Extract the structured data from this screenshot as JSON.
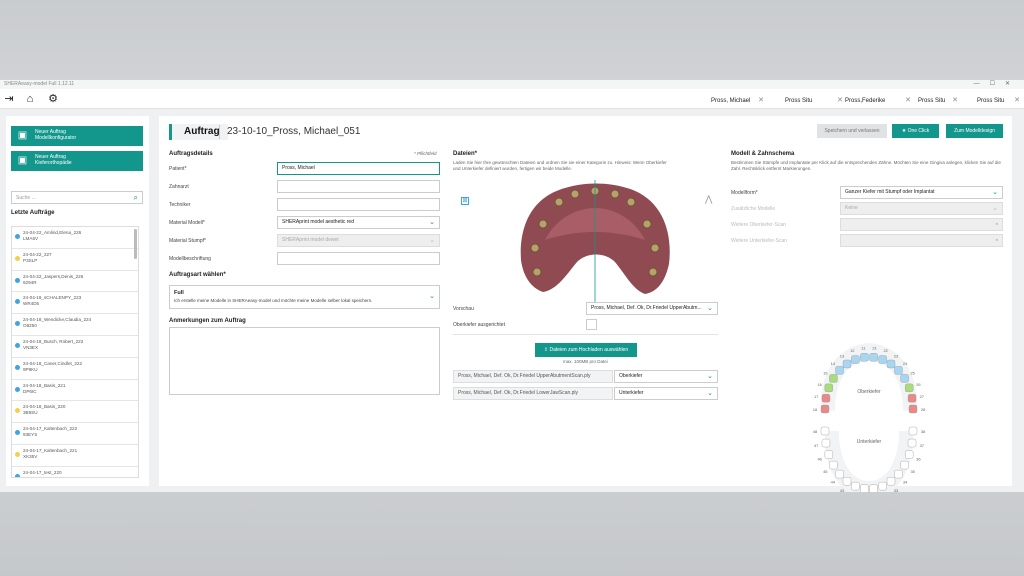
{
  "window": {
    "title": "SHERAeasy-model Full 1.12.11"
  },
  "tabs": [
    {
      "label": "Pross, Michael"
    },
    {
      "label": "Pross Situ"
    },
    {
      "label": "Pross,Federike"
    },
    {
      "label": "Pross Situ"
    },
    {
      "label": "Pross Situ"
    }
  ],
  "sidebar": {
    "new1": {
      "title": "Neuer Auftrag",
      "sub": "Modellkonfigurator"
    },
    "new2": {
      "title": "Neuer Auftrag",
      "sub": "Kieferorthopädie"
    },
    "search_placeholder": "Suche ...",
    "recent_title": "Letzte Aufträge",
    "orders": [
      {
        "name": "24-04-22_Amlind,Elena_226",
        "code": "LMA5V",
        "color": "#3fa4e3"
      },
      {
        "name": "24-04-22_227",
        "code": "P3SLP",
        "color": "#f3d04c"
      },
      {
        "name": "24-04-22_Jaspers,Denis_226",
        "code": "6294R",
        "color": "#3fa4e3"
      },
      {
        "name": "24-04-19_sCHALENPY_223",
        "code": "WR4D5",
        "color": "#3fa4e3"
      },
      {
        "name": "24-04-18_Wendicke,Claudia_224",
        "code": "O8250",
        "color": "#3fa4e3"
      },
      {
        "name": "24-04-18_Busch, Robert_222",
        "code": "VN3EX",
        "color": "#3fa4e3"
      },
      {
        "name": "24-04-18_Caner,Cindlet_222",
        "code": "9P9KU",
        "color": "#3fa4e3"
      },
      {
        "name": "24-04-18_Basis_221",
        "code": "DP6IC",
        "color": "#3fa4e3"
      },
      {
        "name": "24-04-18_Basis_220",
        "code": "3B9SU",
        "color": "#f3d04c"
      },
      {
        "name": "24-04-17_Kaltenbach_222",
        "code": "93EYS",
        "color": "#3fa4e3"
      },
      {
        "name": "24-04-17_Kaltenbach_221",
        "code": "XK35V",
        "color": "#f3d04c"
      },
      {
        "name": "24-04-17_test_220",
        "code": "",
        "color": "#3fa4e3"
      }
    ]
  },
  "header": {
    "label": "Auftrag",
    "title": "23-10-10_Pross, Michael_051",
    "save": "Speichern und verlassen",
    "oneclick": "One Click",
    "modeldesign": "Zum Modelldesign"
  },
  "details": {
    "title": "Auftragsdetails",
    "required": "* Pflichtfeld",
    "fields": [
      {
        "label": "Patient*",
        "value": "Pross, Michael"
      },
      {
        "label": "Zahnarzt",
        "value": ""
      },
      {
        "label": "Techniker",
        "value": ""
      },
      {
        "label": "Material Modell*",
        "value": "SHERAprint model aesthetic red"
      },
      {
        "label": "Material Stumpf*",
        "value": "SHERAprint model dewet"
      },
      {
        "label": "Modellbeschriftung",
        "value": ""
      }
    ],
    "artTitle": "Auftragsart wählen*",
    "artValue": "Full",
    "artDesc": "Ich erstelle meine Modelle in SHERAeasy-model und möchte meine Modelle selber lokal speichern.",
    "notesTitle": "Anmerkungen zum Auftrag"
  },
  "files": {
    "title": "Dateien*",
    "desc": "Laden Sie hier Ihre gewünschten Dateien und ordnen Sie sie einer Kategorie zu. Hinweis: Wenn Oberkiefer und Unterkiefer definiert wurden, fertigen wir beide Modelle.",
    "previewLabel": "Vorschau",
    "previewValue": "Pross, Michael, Def. Ok, Dr.Friedel UpperAbutm...",
    "alignedLabel": "Oberkiefer ausgerichtet",
    "uploadBtn": "Dateien zum Hochladen auswählen",
    "maxSize": "max. 100MB pro Datei",
    "list": [
      {
        "name": "Pross, Michael, Def. Ok, Dr.Friedel UpperAbutmentScan.ply",
        "cat": "Oberkiefer"
      },
      {
        "name": "Pross, Michael, Def. Ok, Dr.Friedel LowerJawScan.ply",
        "cat": "Unterkiefer"
      }
    ]
  },
  "model": {
    "title": "Modell & Zahnschema",
    "desc": "Bestimmen Sie Stümpfe und Implantate per Klick auf die entsprechenden Zähne. Möchten Sie eine Gingiva anlegen, klicken Sie auf die Zahl. Rechtsklick entfernt Markierungen.",
    "rows": [
      {
        "label": "Modellform*",
        "value": "Ganzer Kiefer mit Stumpf oder Implantat",
        "disabled": false
      },
      {
        "label": "Zusätzliche Modelle",
        "value": "Keine",
        "disabled": true
      },
      {
        "label": "Weitere Oberkiefer-Scan",
        "value": "",
        "disabled": true
      },
      {
        "label": "Weitere Unterkiefer-Scan",
        "value": "",
        "disabled": true
      }
    ],
    "upperLabel": "Oberkiefer",
    "lowerLabel": "Unterkiefer",
    "upperNums": [
      "18",
      "17",
      "16",
      "15",
      "14",
      "13",
      "12",
      "11",
      "21",
      "22",
      "23",
      "24",
      "25",
      "26",
      "27",
      "28"
    ],
    "lowerNums": [
      "48",
      "47",
      "46",
      "45",
      "44",
      "43",
      "42",
      "41",
      "31",
      "32",
      "33",
      "34",
      "35",
      "36",
      "37",
      "38"
    ]
  },
  "colors": {
    "accent": "#13968c",
    "blue": "#3fa4e3",
    "yellow": "#f3d04c",
    "toothBlue": "#a7d6f2",
    "toothGreen": "#a8dc7c",
    "toothRed": "#e88a8a"
  }
}
